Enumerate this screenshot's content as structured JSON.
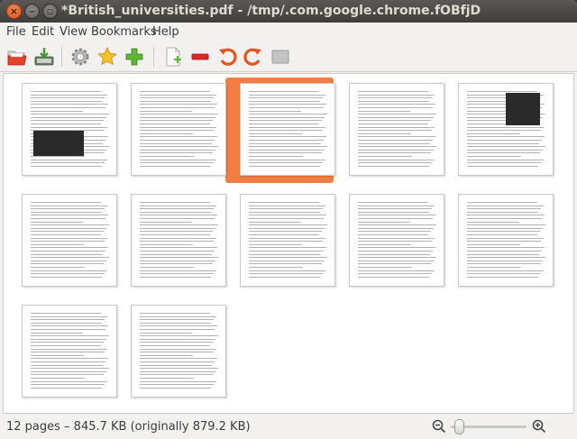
{
  "window": {
    "title": "*British_universities.pdf - /tmp/.com.google.chrome.fOBfjD",
    "close_glyph": "×",
    "minimize_glyph": "–",
    "maximize_glyph": "▫"
  },
  "menubar": {
    "items": [
      "File",
      "Edit",
      "View",
      "Bookmarks",
      "Help"
    ]
  },
  "toolbar": {
    "buttons": [
      {
        "icon": "open-file-icon"
      },
      {
        "icon": "save-icon"
      },
      {
        "icon": "gear-icon"
      },
      {
        "icon": "star-bookmark-icon"
      },
      {
        "icon": "add-icon"
      },
      {
        "icon": "new-page-icon"
      },
      {
        "icon": "remove-icon"
      },
      {
        "icon": "rotate-left-icon"
      },
      {
        "icon": "rotate-right-icon"
      },
      {
        "icon": "crop-icon"
      }
    ]
  },
  "thumbnails": {
    "count": 12,
    "selected_index": 3,
    "selection_color": "#f47d44"
  },
  "statusbar": {
    "text": "12 pages – 845.7 KB (originally 879.2 KB)",
    "zoom_level": 0.05
  }
}
